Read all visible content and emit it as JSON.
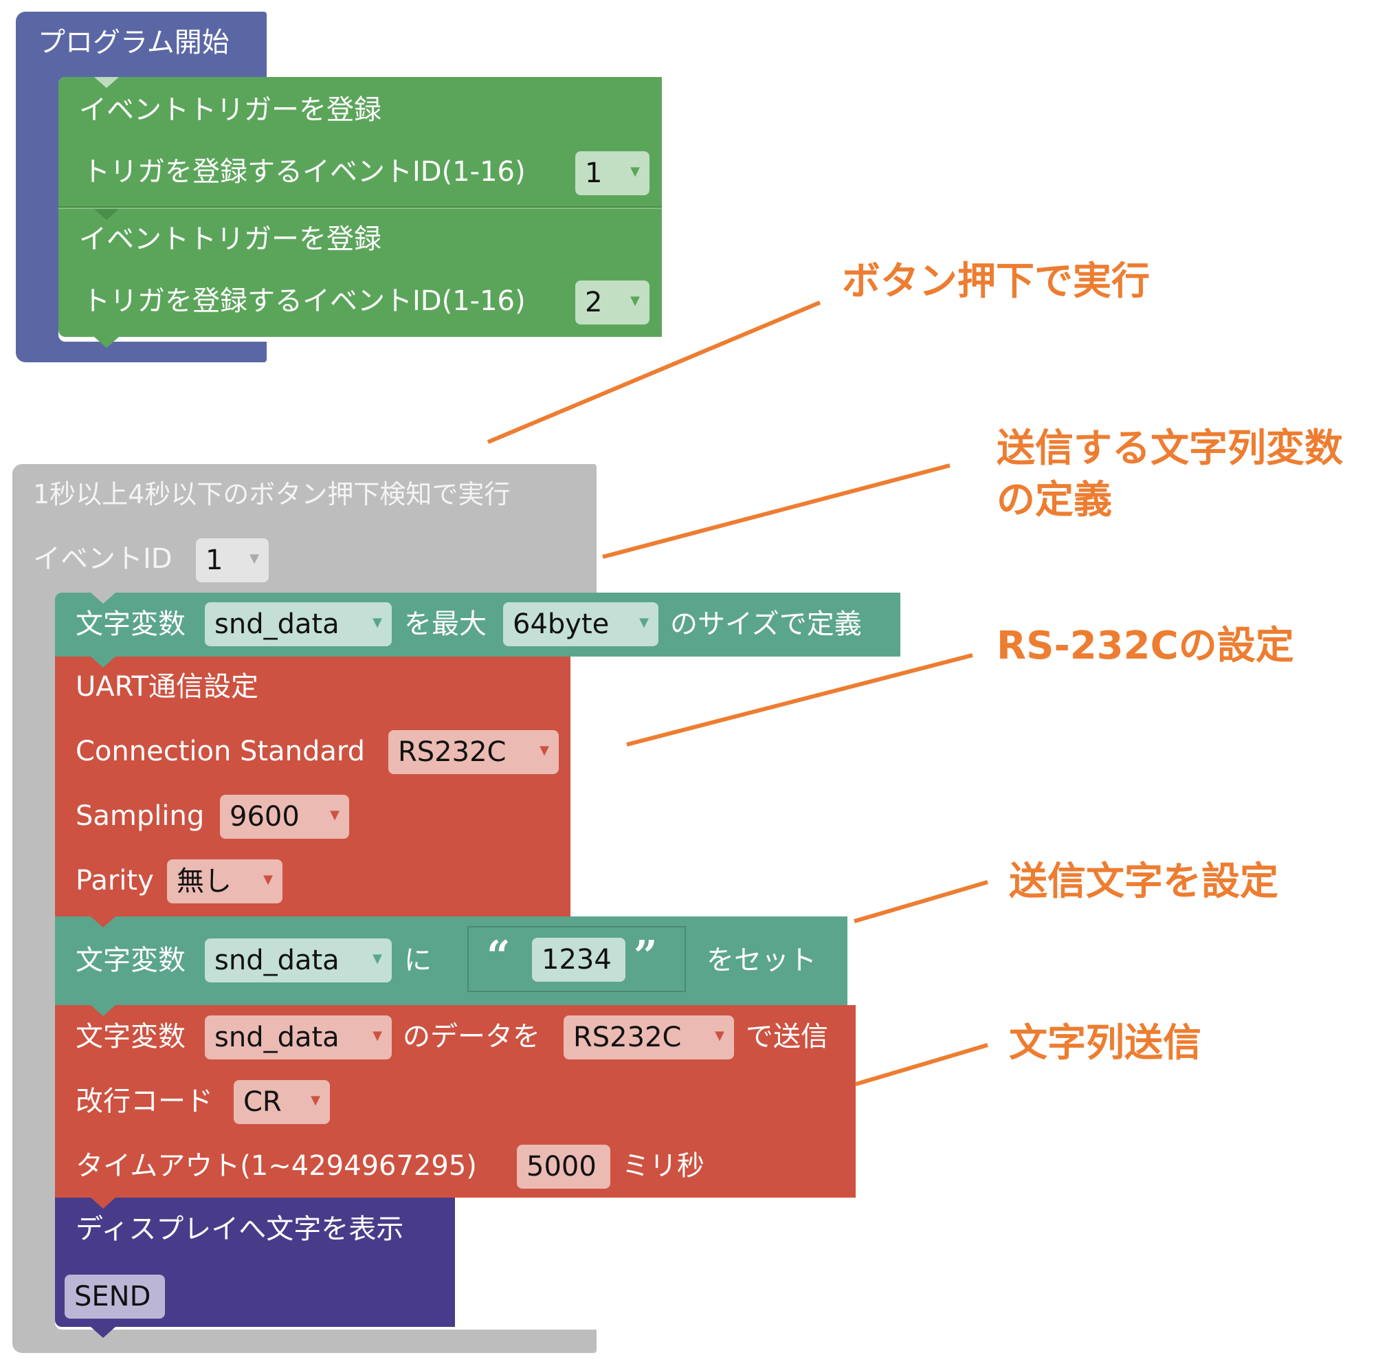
{
  "colors": {
    "program_start": "#5b67a5",
    "event_green": "#5ba55b",
    "event_green_field": "#c3dfc3",
    "event_block_gray": "#bdbdbd",
    "event_field_gray": "#e4e4e4",
    "variable_teal": "#5ba58c",
    "variable_field": "#c3dfd6",
    "uart_red": "#cd5241",
    "uart_field": "#ebbab3",
    "display_purple": "#483c8a",
    "display_field": "#bcb6d6",
    "annotation_orange": "#ed7d31"
  },
  "program_start": {
    "label": "プログラム開始",
    "triggers": [
      {
        "title": "イベントトリガーを登録",
        "field_label": "トリガを登録するイベントID(1-16)",
        "value": "1"
      },
      {
        "title": "イベントトリガーを登録",
        "field_label": "トリガを登録するイベントID(1-16)",
        "value": "2"
      }
    ]
  },
  "event_block": {
    "label": "1秒以上4秒以下のボタン押下検知で実行",
    "event_id_label": "イベントID",
    "event_id_value": "1",
    "define_var": {
      "prefix": "文字変数",
      "var_name": "snd_data",
      "mid": "を最大",
      "size": "64byte",
      "suffix": "のサイズで定義"
    },
    "uart": {
      "title": "UART通信設定",
      "connection_label": "Connection Standard",
      "connection_value": "RS232C",
      "sampling_label": "Sampling",
      "sampling_value": "9600",
      "parity_label": "Parity",
      "parity_value": "無し"
    },
    "set_var": {
      "prefix": "文字変数",
      "var_name": "snd_data",
      "mid": "に",
      "open_quote": "“",
      "string_value": "1234",
      "close_quote": "”",
      "suffix": "をセット"
    },
    "send": {
      "prefix": "文字変数",
      "var_name": "snd_data",
      "mid": "のデータを",
      "port": "RS232C",
      "suffix": "で送信",
      "newline_label": "改行コード",
      "newline_value": "CR",
      "timeout_label": "タイムアウト(1~4294967295)",
      "timeout_value": "5000",
      "timeout_unit": "ミリ秒"
    },
    "display": {
      "title": "ディスプレイへ文字を表示",
      "text_value": "SEND"
    }
  },
  "annotations": [
    {
      "text": "ボタン押下で実行"
    },
    {
      "line1": "送信する文字列変数",
      "line2": "の定義"
    },
    {
      "text": "RS-232Cの設定"
    },
    {
      "text": "送信文字を設定"
    },
    {
      "text": "文字列送信"
    }
  ],
  "dropdown_arrow": "▼"
}
